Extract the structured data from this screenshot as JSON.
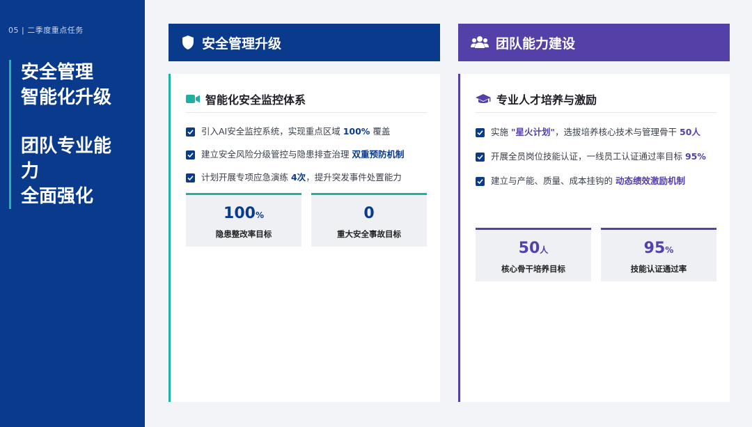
{
  "sidebar": {
    "section": "05 | 二季度重点任务",
    "headline_a": [
      "安全管理",
      "智能化升级"
    ],
    "headline_b": [
      "团队专业能",
      "力",
      "全面强化"
    ]
  },
  "left": {
    "header": "安全管理升级",
    "header_icon": "shield-icon",
    "subtitle": "智能化安全监控体系",
    "subtitle_icon": "video-camera-icon",
    "items": [
      {
        "text": "引入AI安全监控系统，实现重点区域 ",
        "highlight": "100%",
        "after": " 覆盖"
      },
      {
        "text": "建立安全风险分级管控与隐患排查治理 ",
        "highlight": "双重预防机制",
        "after": ""
      },
      {
        "text": "计划开展专项应急演练 ",
        "highlight": "4次",
        "after": "，提升突发事件处置能力"
      }
    ],
    "stats": [
      {
        "value": "100",
        "unit": "%",
        "label": "隐患整改率目标"
      },
      {
        "value": "0",
        "unit": "",
        "label": "重大安全事故目标"
      }
    ]
  },
  "right": {
    "header": "团队能力建设",
    "header_icon": "users-icon",
    "subtitle": "专业人才培养与激励",
    "subtitle_icon": "graduation-cap-icon",
    "items": [
      {
        "text": "实施 ",
        "highlight": "\"星火计划\"",
        "after": "，选拔培养核心技术与管理骨干 ",
        "highlight2": "50人"
      },
      {
        "text": "开展全员岗位技能认证，一线员工认证通过率目标 ",
        "highlight": "95%",
        "after": ""
      },
      {
        "text": "建立与产能、质量、成本挂钩的 ",
        "highlight": "动态绩效激励机制",
        "after": ""
      }
    ],
    "stats": [
      {
        "value": "50",
        "unit": "人",
        "label": "核心骨干培养目标"
      },
      {
        "value": "95",
        "unit": "%",
        "label": "技能认证通过率"
      }
    ]
  },
  "colors": {
    "navy": "#0a3a8c",
    "purple": "#5540a8",
    "teal": "#1eb0a3"
  }
}
